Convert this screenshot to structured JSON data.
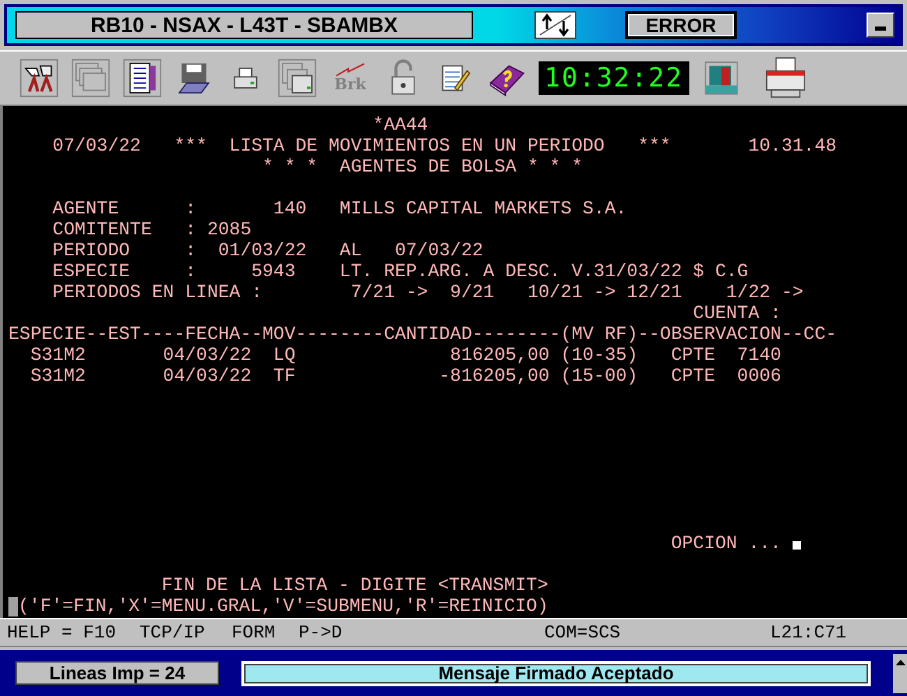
{
  "title_bar": {
    "session": "RB10 - NSAX - L43T - SBAMBX",
    "status": "ERROR"
  },
  "toolbar": {
    "brk_label": "Brk",
    "clock": "10:32:22"
  },
  "terminal": {
    "header_lines": [
      "                                 *AA44",
      "    07/03/22   ***  LISTA DE MOVIMIENTOS EN UN PERIODO   ***       10.31.48",
      "                       * * *  AGENTES DE BOLSA * * *"
    ],
    "detail_lines": [
      "    AGENTE      :       140   MILLS CAPITAL MARKETS S.A.",
      "    COMITENTE   : 2085",
      "    PERIODO     :  01/03/22   AL   07/03/22",
      "    ESPECIE     :     5943    LT. REP.ARG. A DESC. V.31/03/22 $ C.G",
      "    PERIODOS EN LINEA :        7/21 ->  9/21   10/21 -> 12/21    1/22 ->",
      "                                                              CUENTA :"
    ],
    "table_lines": [
      "ESPECIE--EST----FECHA--MOV--------CANTIDAD--------(MV RF)--OBSERVACION--CC-",
      "  S31M2       04/03/22  LQ              816205,00 (10-35)   CPTE  7140",
      "  S31M2       04/03/22  TF             -816205,00 (15-00)   CPTE  0006"
    ],
    "option_prompt": "                                                            OPCION ...",
    "footer_lines": [
      "             FIN DE LA LISTA - DIGITE <TRANSMIT>",
      "('F'=FIN,'X'=MENU.GRAL,'V'=SUBMENU,'R'=REINICIO)"
    ]
  },
  "status_bar": [
    "HELP = F10",
    "TCP/IP",
    "FORM",
    "P->D",
    "COM=SCS",
    "L21:C71"
  ],
  "message_bar": {
    "lines_count": "Lineas Imp = 24",
    "message": "Mensaje Firmado Aceptado"
  }
}
